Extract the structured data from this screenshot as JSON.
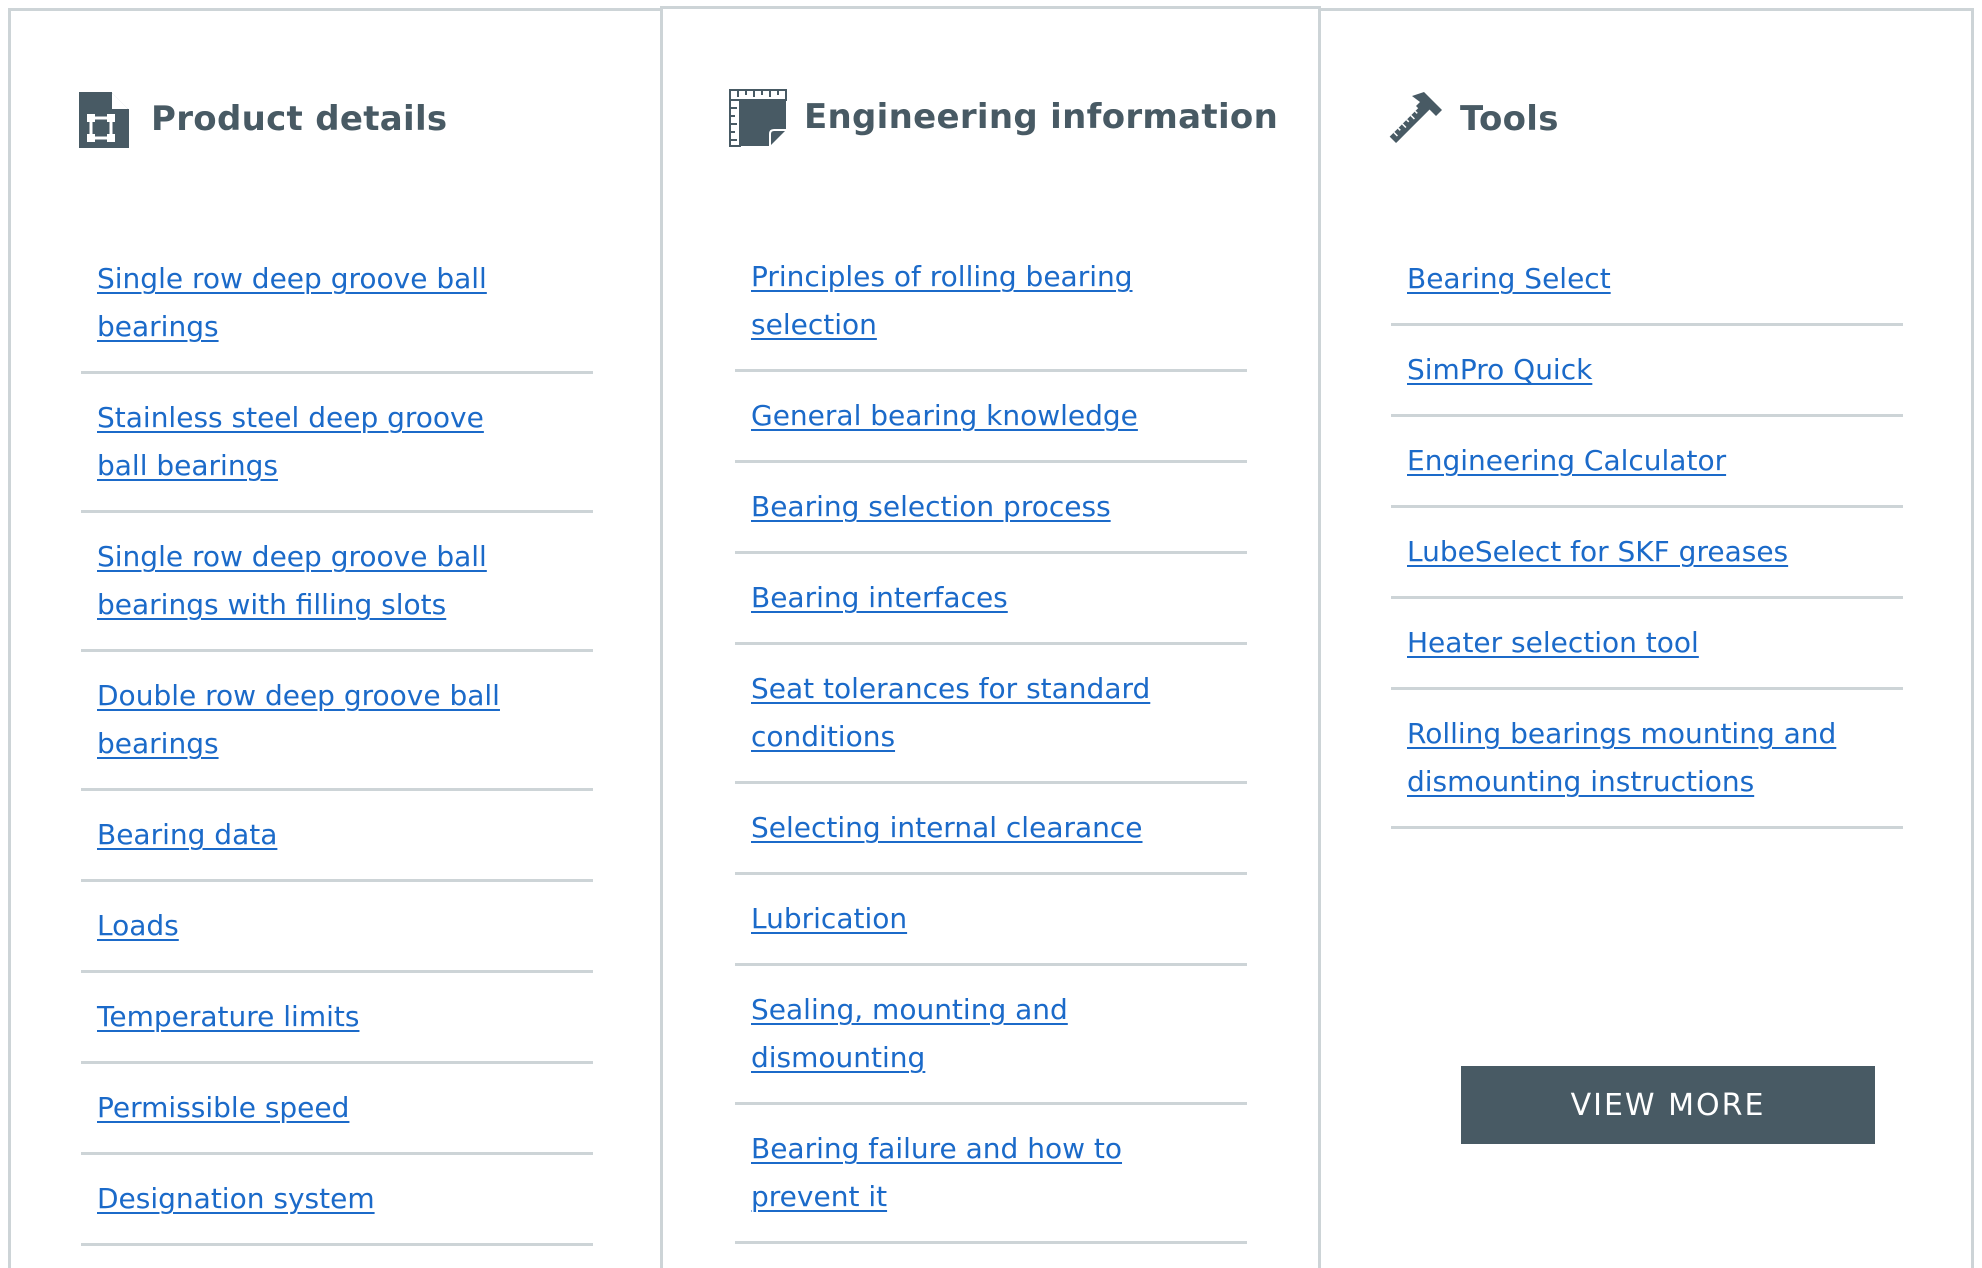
{
  "panels": [
    {
      "title": "Product details",
      "icon": "document-frame-icon",
      "links": [
        "Single row deep groove ball bearings",
        "Stainless steel deep groove ball bearings",
        "Single row deep groove ball bearings with filling slots",
        "Double row deep groove ball bearings",
        "Bearing data",
        "Loads",
        "Temperature limits",
        "Permissible speed",
        "Designation system"
      ]
    },
    {
      "title": "Engineering information",
      "icon": "ruler-notebook-icon",
      "links": [
        "Principles of rolling bearing selection",
        "General bearing knowledge",
        "Bearing selection process",
        "Bearing interfaces",
        "Seat tolerances for standard conditions",
        "Selecting internal clearance",
        "Lubrication",
        "Sealing, mounting and dismounting",
        "Bearing failure and how to prevent it"
      ]
    },
    {
      "title": "Tools",
      "icon": "hammer-ruler-icon",
      "links": [
        "Bearing Select",
        "SimPro Quick",
        "Engineering Calculator",
        "LubeSelect for SKF greases",
        "Heater selection tool",
        "Rolling bearings mounting and dismounting instructions"
      ],
      "button_label": "VIEW MORE"
    }
  ],
  "colors": {
    "link": "#1b6ac9",
    "heading": "#485a64",
    "divider": "#cdd4d7",
    "button_bg": "#485a64",
    "button_text": "#ffffff"
  }
}
